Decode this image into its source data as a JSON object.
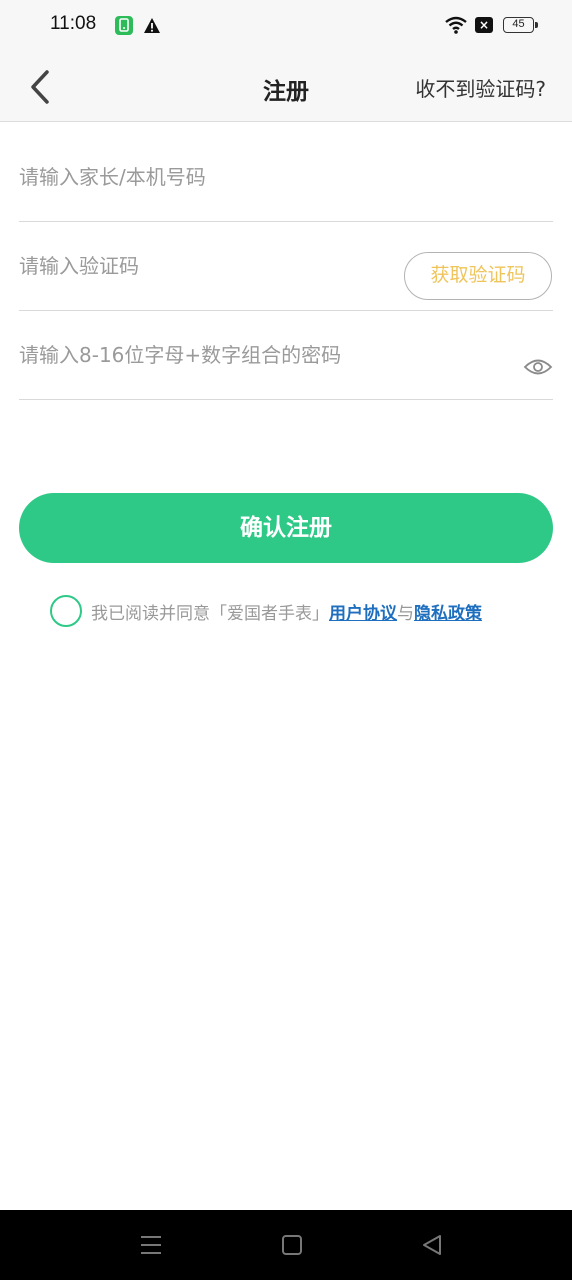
{
  "status_bar": {
    "time": "11:08",
    "notification_icons": [
      "app-notification-icon",
      "warning-icon"
    ],
    "status_icons": [
      "wifi-icon",
      "no-sim-icon",
      "battery-icon"
    ],
    "battery_level": "45"
  },
  "header": {
    "title": "注册",
    "back_icon": "chevron-left-icon",
    "no_code_link": "收不到验证码?"
  },
  "form": {
    "phone_placeholder": "请输入家长/本机号码",
    "phone_value": "",
    "code_placeholder": "请输入验证码",
    "code_value": "",
    "get_code_label": "获取验证码",
    "password_placeholder": "请输入8-16位字母+数字组合的密码",
    "password_value": "",
    "password_visibility_icon": "eye-icon",
    "confirm_label": "确认注册"
  },
  "agreement": {
    "checked": false,
    "text": "我已阅读并同意「爱国者手表」",
    "user_agreement": "用户协议",
    "and": "与",
    "privacy_policy": "隐私政策"
  },
  "nav_bar": {
    "icons": [
      "menu-icon",
      "home-icon",
      "back-triangle-icon"
    ]
  },
  "colors": {
    "accent_green": "#2ec987",
    "get_code_text": "#efc45a",
    "link_blue": "#1f6fbf",
    "placeholder_gray": "#9a9a9a"
  }
}
